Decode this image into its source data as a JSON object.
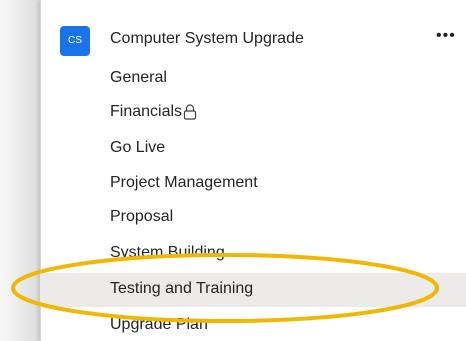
{
  "team": {
    "avatar_text": "CS",
    "name": "Computer System Upgrade",
    "more_icon": "ellipsis-icon",
    "more_label": "•••"
  },
  "channels": [
    {
      "label": "General",
      "active": false
    },
    {
      "label": "Financials",
      "active": false,
      "icon": "lock-icon"
    },
    {
      "label": "Go Live",
      "active": false
    },
    {
      "label": "Project Management",
      "active": false
    },
    {
      "label": "Proposal",
      "active": false
    },
    {
      "label": "System Building",
      "active": false
    },
    {
      "label": "Testing and Training",
      "active": true
    },
    {
      "label": "Upgrade Plan",
      "active": false
    }
  ],
  "colors": {
    "accent": "#1a73e8",
    "highlight_ring": "#f2b705",
    "active_row": "#ecebea",
    "text": "#242424"
  }
}
